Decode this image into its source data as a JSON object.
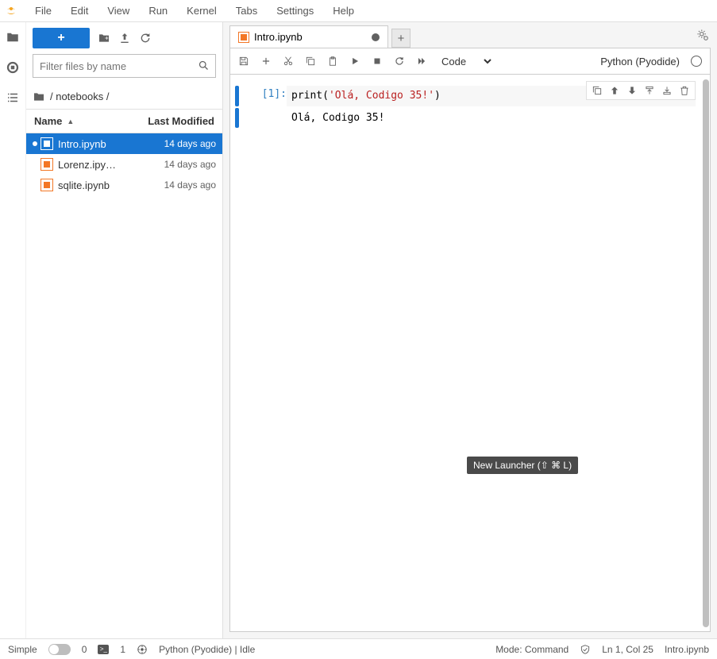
{
  "menubar": [
    "File",
    "Edit",
    "View",
    "Run",
    "Kernel",
    "Tabs",
    "Settings",
    "Help"
  ],
  "sidebar": {
    "filter_placeholder": "Filter files by name",
    "breadcrumb": "/ notebooks /",
    "columns": {
      "name": "Name",
      "modified": "Last Modified"
    },
    "files": [
      {
        "name": "Intro.ipynb",
        "modified": "14 days ago",
        "selected": true,
        "dirty": true
      },
      {
        "name": "Lorenz.ipy…",
        "modified": "14 days ago",
        "selected": false,
        "dirty": false
      },
      {
        "name": "sqlite.ipynb",
        "modified": "14 days ago",
        "selected": false,
        "dirty": false
      }
    ]
  },
  "tab": {
    "title": "Intro.ipynb",
    "dirty": true
  },
  "notebook_toolbar": {
    "cell_type": "Code",
    "kernel": "Python (Pyodide)"
  },
  "cell": {
    "prompt": "[1]:",
    "code_fn": "print",
    "code_open": "(",
    "code_str": "'Olá, Codigo 35!'",
    "code_close": ")",
    "output": "Olá, Codigo 35!"
  },
  "tooltip": "New Launcher (⇧ ⌘ L)",
  "status": {
    "simple": "Simple",
    "tabs_count": "0",
    "terminals_count": "1",
    "kernel": "Python (Pyodide) | Idle",
    "mode": "Mode: Command",
    "cursor": "Ln 1, Col 25",
    "file": "Intro.ipynb"
  }
}
